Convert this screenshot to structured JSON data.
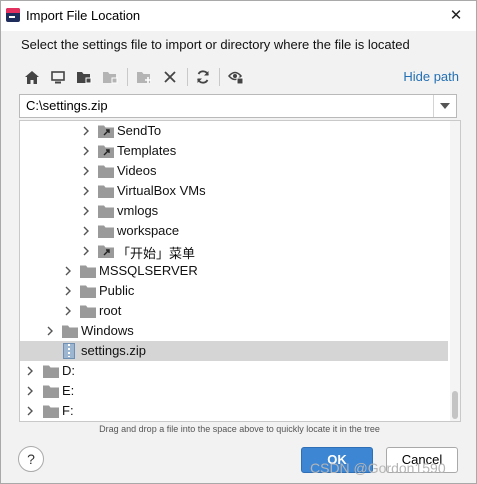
{
  "window": {
    "title": "Import File Location",
    "close_glyph": "✕"
  },
  "instruction": "Select the settings file to import or directory where the file is located",
  "toolbar": {
    "icons": [
      "home-icon",
      "desktop-icon",
      "project-folder-icon",
      "module-folder-icon",
      "new-folder-icon",
      "delete-icon",
      "refresh-icon",
      "show-hidden-icon"
    ],
    "hide_path_label": "Hide path"
  },
  "path": {
    "value": "C:\\settings.zip"
  },
  "tree": {
    "rows": [
      {
        "label": "SendTo",
        "type": "shortcut-folder"
      },
      {
        "label": "Templates",
        "type": "shortcut-folder"
      },
      {
        "label": "Videos",
        "type": "folder"
      },
      {
        "label": "VirtualBox VMs",
        "type": "folder"
      },
      {
        "label": "vmlogs",
        "type": "folder"
      },
      {
        "label": "workspace",
        "type": "folder"
      },
      {
        "label": "「开始」菜单",
        "type": "shortcut-folder"
      },
      {
        "label": "MSSQLSERVER",
        "type": "folder"
      },
      {
        "label": "Public",
        "type": "folder"
      },
      {
        "label": "root",
        "type": "folder"
      },
      {
        "label": "Windows",
        "type": "folder"
      },
      {
        "label": "settings.zip",
        "type": "zip-file"
      },
      {
        "label": "D:",
        "type": "drive"
      },
      {
        "label": "E:",
        "type": "drive"
      },
      {
        "label": "F:",
        "type": "drive"
      }
    ]
  },
  "hint": "Drag and drop a file into the space above to quickly locate it in the tree",
  "buttons": {
    "help": "?",
    "ok": "OK",
    "cancel": "Cancel"
  },
  "watermark": "CSDN @Gordon1590"
}
